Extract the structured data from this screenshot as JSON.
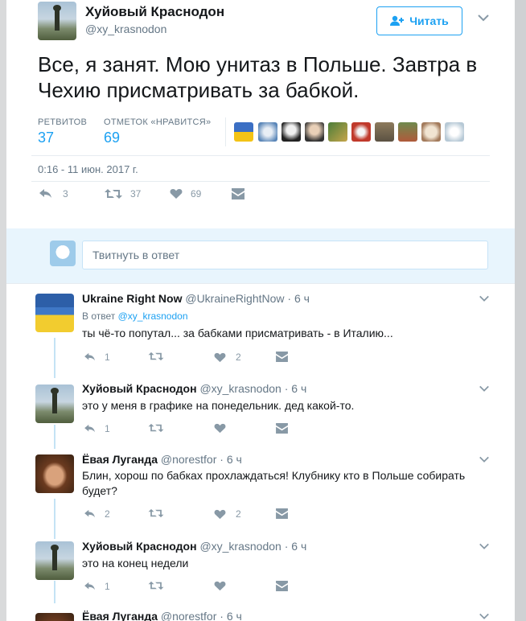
{
  "main_tweet": {
    "author_name": "Хуйовый Краснодон",
    "author_handle": "@xy_krasnodon",
    "follow_label": "Читать",
    "text": "Все, я занят. Мою унитаз в Польше. Завтра в Чехию присматривать за бабкой.",
    "retweets_label": "РЕТВИТОВ",
    "retweets_count": "37",
    "likes_label": "ОТМЕТОК «НРАВИТСЯ»",
    "likes_count": "69",
    "timestamp": "0:16 - 11 июн. 2017 г.",
    "actions": {
      "reply_count": "3",
      "retweet_count": "37",
      "like_count": "69"
    }
  },
  "reply_box": {
    "placeholder": "Твитнуть в ответ"
  },
  "replies": [
    {
      "author_name": "Ukraine Right Now",
      "author_handle": "@UkraineRightNow",
      "time": "6 ч",
      "in_reply_prefix": "В ответ",
      "in_reply_handle": "@xy_krasnodon",
      "text": "ты чё-то попутал... за бабками присматривать - в Италию...",
      "reply_count": "1",
      "retweet_count": "",
      "like_count": "2"
    },
    {
      "author_name": "Хуйовый Краснодон",
      "author_handle": "@xy_krasnodon",
      "time": "6 ч",
      "text": "это у меня в графике на понедельник. дед какой-то.",
      "reply_count": "1",
      "retweet_count": "",
      "like_count": ""
    },
    {
      "author_name": "Ёвая Луганда",
      "author_handle": "@norestfor",
      "time": "6 ч",
      "text": "Блин, хорош по бабках прохлаждаться! Клубнику кто в Польше собирать будет?",
      "reply_count": "2",
      "retweet_count": "",
      "like_count": "2"
    },
    {
      "author_name": "Хуйовый Краснодон",
      "author_handle": "@xy_krasnodon",
      "time": "6 ч",
      "text": "это на конец недели",
      "reply_count": "1",
      "retweet_count": "",
      "like_count": ""
    },
    {
      "author_name": "Ёвая Луганда",
      "author_handle": "@norestfor",
      "time": "6 ч"
    }
  ],
  "colors": {
    "accent": "#1da1f2",
    "muted": "#657786",
    "icon": "#8899a6",
    "reply_bar": "#e8f5fd"
  },
  "icons": [
    "person-add-icon",
    "chevron-down-icon",
    "reply-icon",
    "retweet-icon",
    "heart-icon",
    "direct-message-icon"
  ]
}
